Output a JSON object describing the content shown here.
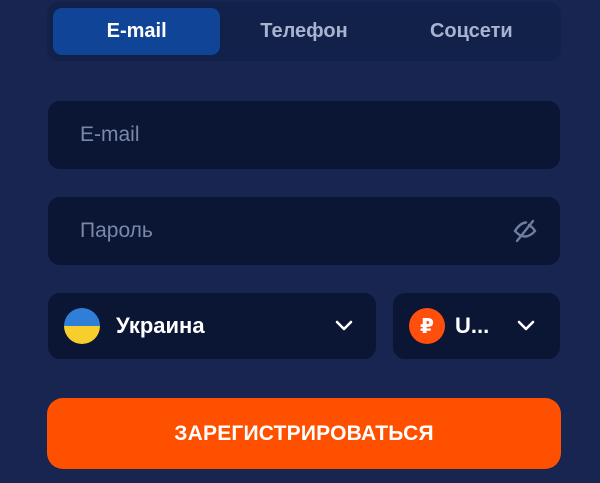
{
  "tabs": [
    {
      "label": "E-mail",
      "active": true
    },
    {
      "label": "Телефон",
      "active": false
    },
    {
      "label": "Соцсети",
      "active": false
    }
  ],
  "email": {
    "placeholder": "E-mail",
    "value": ""
  },
  "password": {
    "placeholder": "Пароль",
    "value": "",
    "toggle_icon": "eye-off-icon"
  },
  "country": {
    "label": "Украина",
    "flag_icon": "ukraine-flag-icon",
    "chevron_icon": "chevron-down-icon"
  },
  "currency": {
    "label": "U...",
    "symbol": "₽",
    "icon": "ruble-icon",
    "chevron_icon": "chevron-down-icon"
  },
  "submit": {
    "label": "ЗАРЕГИСТРИРОВАТЬСЯ"
  },
  "colors": {
    "background": "#182550",
    "field": "#0b1534",
    "active_tab": "#0f4497",
    "accent": "#ff5000"
  }
}
